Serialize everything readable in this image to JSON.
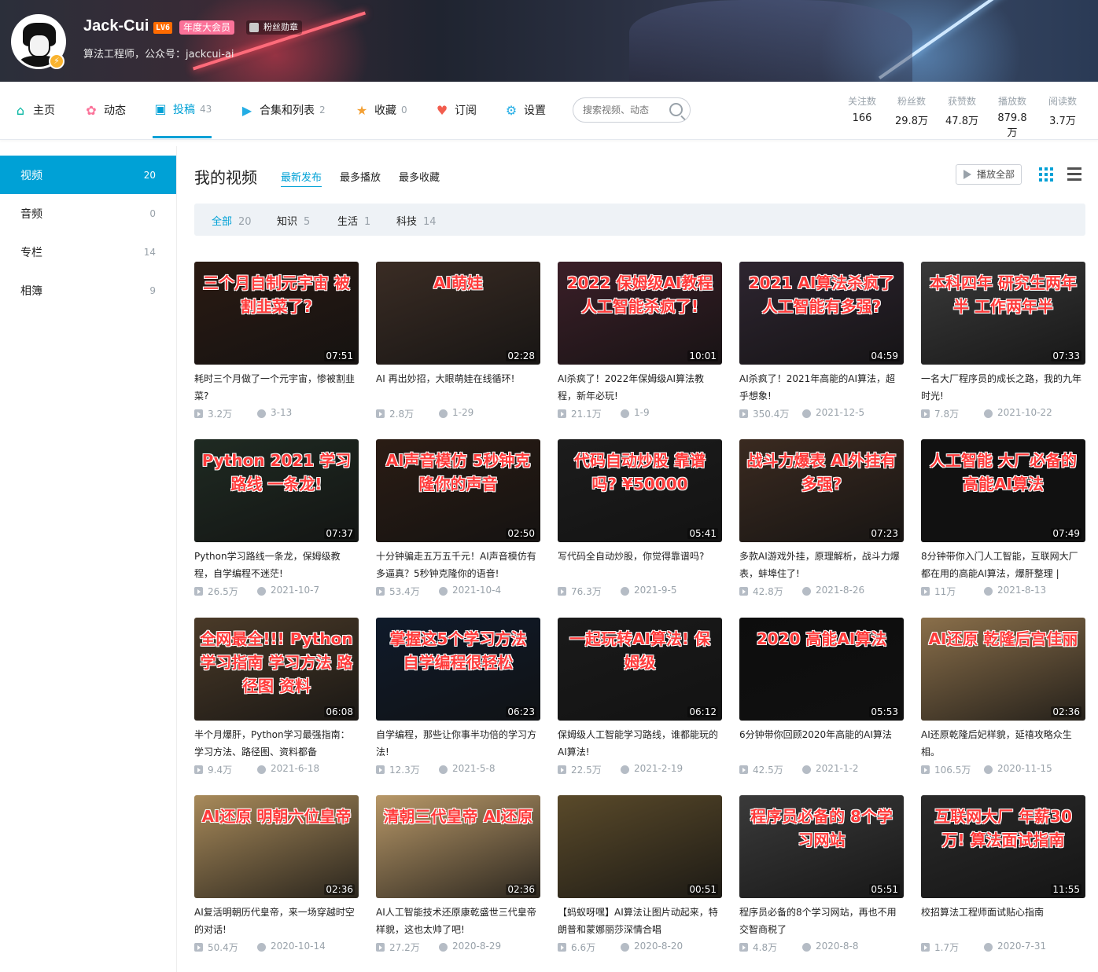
{
  "profile": {
    "name": "Jack-Cui",
    "level": "LV6",
    "vip_badge": "年度大会员",
    "medal": "粉丝勋章",
    "sign": "算法工程师，公众号：jackcui-ai"
  },
  "nav": {
    "items": [
      {
        "label": "主页",
        "count": "",
        "icon": "home-icon"
      },
      {
        "label": "动态",
        "count": "",
        "icon": "dynamic-icon"
      },
      {
        "label": "投稿",
        "count": "43",
        "icon": "upload-icon"
      },
      {
        "label": "合集和列表",
        "count": "2",
        "icon": "collection-icon"
      },
      {
        "label": "收藏",
        "count": "0",
        "icon": "star-icon"
      },
      {
        "label": "订阅",
        "count": "",
        "icon": "heart-icon"
      },
      {
        "label": "设置",
        "count": "",
        "icon": "gear-icon"
      }
    ],
    "search_placeholder": "搜索视频、动态",
    "stats": [
      {
        "label": "关注数",
        "value": "166"
      },
      {
        "label": "粉丝数",
        "value": "29.8万"
      },
      {
        "label": "获赞数",
        "value": "47.8万"
      },
      {
        "label": "播放数",
        "value": "879.8万"
      },
      {
        "label": "阅读数",
        "value": "3.7万"
      }
    ]
  },
  "sidebar": {
    "items": [
      {
        "label": "视频",
        "count": "20"
      },
      {
        "label": "音频",
        "count": "0"
      },
      {
        "label": "专栏",
        "count": "14"
      },
      {
        "label": "相簿",
        "count": "9"
      }
    ]
  },
  "main": {
    "title": "我的视频",
    "sorts": [
      "最新发布",
      "最多播放",
      "最多收藏"
    ],
    "play_all": "播放全部",
    "filters": [
      {
        "label": "全部",
        "count": "20"
      },
      {
        "label": "知识",
        "count": "5"
      },
      {
        "label": "生活",
        "count": "1"
      },
      {
        "label": "科技",
        "count": "14"
      }
    ]
  },
  "videos": [
    {
      "thumb_text": "三个月自制元宇宙 被割韭菜了?",
      "duration": "07:51",
      "title": "耗时三个月做了一个元宇宙，惨被割韭菜?",
      "views": "3.2万",
      "date": "3-13",
      "bg": "#2a1a12"
    },
    {
      "thumb_text": "AI萌娃",
      "duration": "02:28",
      "title": "AI 再出妙招，大眼萌娃在线循环!",
      "views": "2.8万",
      "date": "1-29",
      "bg": "#3a2c24"
    },
    {
      "thumb_text": "2022 保姆级AI教程 人工智能杀疯了!",
      "duration": "10:01",
      "title": "AI杀疯了！2022年保姆级AI算法教程，新年必玩!",
      "views": "21.1万",
      "date": "1-9",
      "bg": "#3b1f28"
    },
    {
      "thumb_text": "2021 AI算法杀疯了 人工智能有多强?",
      "duration": "04:59",
      "title": "AI杀疯了！2021年高能的AI算法，超乎想象!",
      "views": "350.4万",
      "date": "2021-12-5",
      "bg": "#2e2530"
    },
    {
      "thumb_text": "本科四年 研究生两年半 工作两年半",
      "duration": "07:33",
      "title": "一名大厂程序员的成长之路，我的九年时光!",
      "views": "7.8万",
      "date": "2021-10-22",
      "bg": "#3a3a3a"
    },
    {
      "thumb_text": "Python 2021 学习路线 一条龙!",
      "duration": "07:37",
      "title": "Python学习路线一条龙，保姆级教程，自学编程不迷茫!",
      "views": "26.5万",
      "date": "2021-10-7",
      "bg": "#1f2a22"
    },
    {
      "thumb_text": "AI声音模仿 5秒钟克隆你的声音",
      "duration": "02:50",
      "title": "十分钟骗走五万五千元！AI声音模仿有多逼真？5秒钟克隆你的语音!",
      "views": "53.4万",
      "date": "2021-10-4",
      "bg": "#2a1c14"
    },
    {
      "thumb_text": "代码自动炒股 靠谱吗? ¥50000",
      "duration": "05:41",
      "title": "写代码全自动炒股，你觉得靠谱吗?",
      "views": "76.3万",
      "date": "2021-9-5",
      "bg": "#1c1c1c"
    },
    {
      "thumb_text": "战斗力爆表 AI外挂有多强?",
      "duration": "07:23",
      "title": "多款AI游戏外挂，原理解析，战斗力爆表，蚌埠住了!",
      "views": "42.8万",
      "date": "2021-8-26",
      "bg": "#3a2a20"
    },
    {
      "thumb_text": "人工智能 大厂必备的高能AI算法",
      "duration": "07:49",
      "title": "8分钟带你入门人工智能，互联网大厂都在用的高能AI算法，爆肝整理 |",
      "views": "11万",
      "date": "2021-8-13",
      "bg": "#111111"
    },
    {
      "thumb_text": "全网最全!!! Python学习指南 学习方法 路径图 资料",
      "duration": "06:08",
      "title": "半个月爆肝，Python学习最强指南：学习方法、路径图、资料都备",
      "views": "9.4万",
      "date": "2021-6-18",
      "bg": "#4a3a28"
    },
    {
      "thumb_text": "掌握这5个学习方法 自学编程很轻松",
      "duration": "06:23",
      "title": "自学编程，那些让你事半功倍的学习方法!",
      "views": "12.3万",
      "date": "2021-5-8",
      "bg": "#0f1a2a"
    },
    {
      "thumb_text": "一起玩转AI算法! 保姆级",
      "duration": "06:12",
      "title": "保姆级人工智能学习路线，谁都能玩的AI算法!",
      "views": "22.5万",
      "date": "2021-2-19",
      "bg": "#1a1a1a"
    },
    {
      "thumb_text": "2020 高能AI算法",
      "duration": "05:53",
      "title": "6分钟带你回顾2020年高能的AI算法",
      "views": "42.5万",
      "date": "2021-1-2",
      "bg": "#0d0d0d"
    },
    {
      "thumb_text": "AI还原 乾隆后宫佳丽",
      "duration": "02:36",
      "title": "AI还原乾隆后妃样貌，延禧攻略众生相。",
      "views": "106.5万",
      "date": "2020-11-15",
      "bg": "#8a6f4a"
    },
    {
      "thumb_text": "AI还原 明朝六位皇帝",
      "duration": "02:36",
      "title": "AI复活明朝历代皇帝，来一场穿越时空的对话!",
      "views": "50.4万",
      "date": "2020-10-14",
      "bg": "#a88a5a"
    },
    {
      "thumb_text": "清朝三代皇帝 AI还原",
      "duration": "02:36",
      "title": "AI人工智能技术还原康乾盛世三代皇帝样貌，这也太帅了吧!",
      "views": "27.2万",
      "date": "2020-8-29",
      "bg": "#b89868"
    },
    {
      "thumb_text": "",
      "duration": "00:51",
      "title": "【蚂蚁呀嘿】AI算法让图片动起来，特朗普和蒙娜丽莎深情合唱",
      "views": "6.6万",
      "date": "2020-8-20",
      "bg": "#5a4a2a"
    },
    {
      "thumb_text": "程序员必备的 8个学习网站",
      "duration": "05:51",
      "title": "程序员必备的8个学习网站，再也不用交智商税了",
      "views": "4.8万",
      "date": "2020-8-8",
      "bg": "#3a3a3a"
    },
    {
      "thumb_text": "互联网大厂 年薪30万! 算法面试指南",
      "duration": "11:55",
      "title": "校招算法工程师面试贴心指南",
      "views": "1.7万",
      "date": "2020-7-31",
      "bg": "#2a2a2a"
    }
  ]
}
